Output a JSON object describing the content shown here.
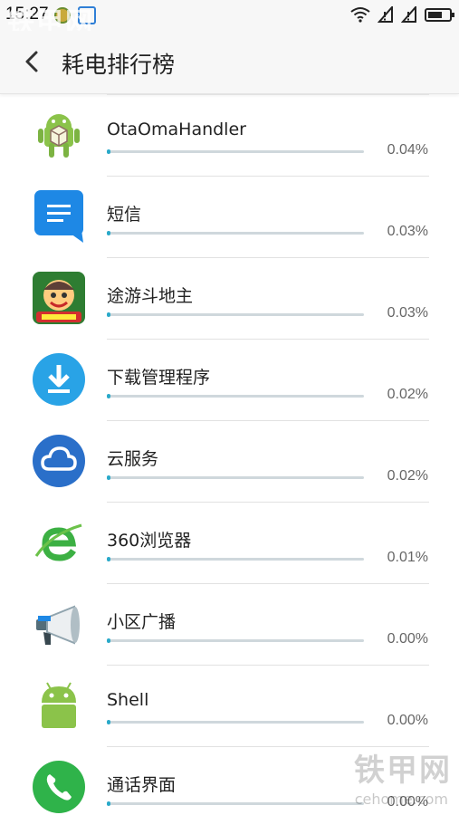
{
  "status_bar": {
    "time": "15:27",
    "icons": [
      "notification-icon-a",
      "screenshot-icon",
      "wifi-icon",
      "signal-icon",
      "signal-icon",
      "battery-icon"
    ],
    "battery_level": 0.7
  },
  "watermark": {
    "brand": "铁甲网",
    "url": "cehome.com"
  },
  "header": {
    "back_icon": "chevron-left-icon",
    "title": "耗电排行榜"
  },
  "colors": {
    "accent": "#2aa9c9",
    "track": "#cfd8dc"
  },
  "apps": [
    {
      "name": "OtaOmaHandler",
      "percent": "0.04%",
      "usage": 0.04,
      "icon": "android-package-icon"
    },
    {
      "name": "短信",
      "percent": "0.03%",
      "usage": 0.03,
      "icon": "message-icon"
    },
    {
      "name": "途游斗地主",
      "percent": "0.03%",
      "usage": 0.03,
      "icon": "game-avatar-icon"
    },
    {
      "name": "下载管理程序",
      "percent": "0.02%",
      "usage": 0.02,
      "icon": "download-icon"
    },
    {
      "name": "云服务",
      "percent": "0.02%",
      "usage": 0.02,
      "icon": "cloud-icon"
    },
    {
      "name": "360浏览器",
      "percent": "0.01%",
      "usage": 0.01,
      "icon": "browser-e-icon"
    },
    {
      "name": "小区广播",
      "percent": "0.00%",
      "usage": 0.0,
      "icon": "megaphone-icon"
    },
    {
      "name": "Shell",
      "percent": "0.00%",
      "usage": 0.0,
      "icon": "android-icon"
    },
    {
      "name": "通话界面",
      "percent": "0.00%",
      "usage": 0.0,
      "icon": "phone-icon"
    }
  ]
}
